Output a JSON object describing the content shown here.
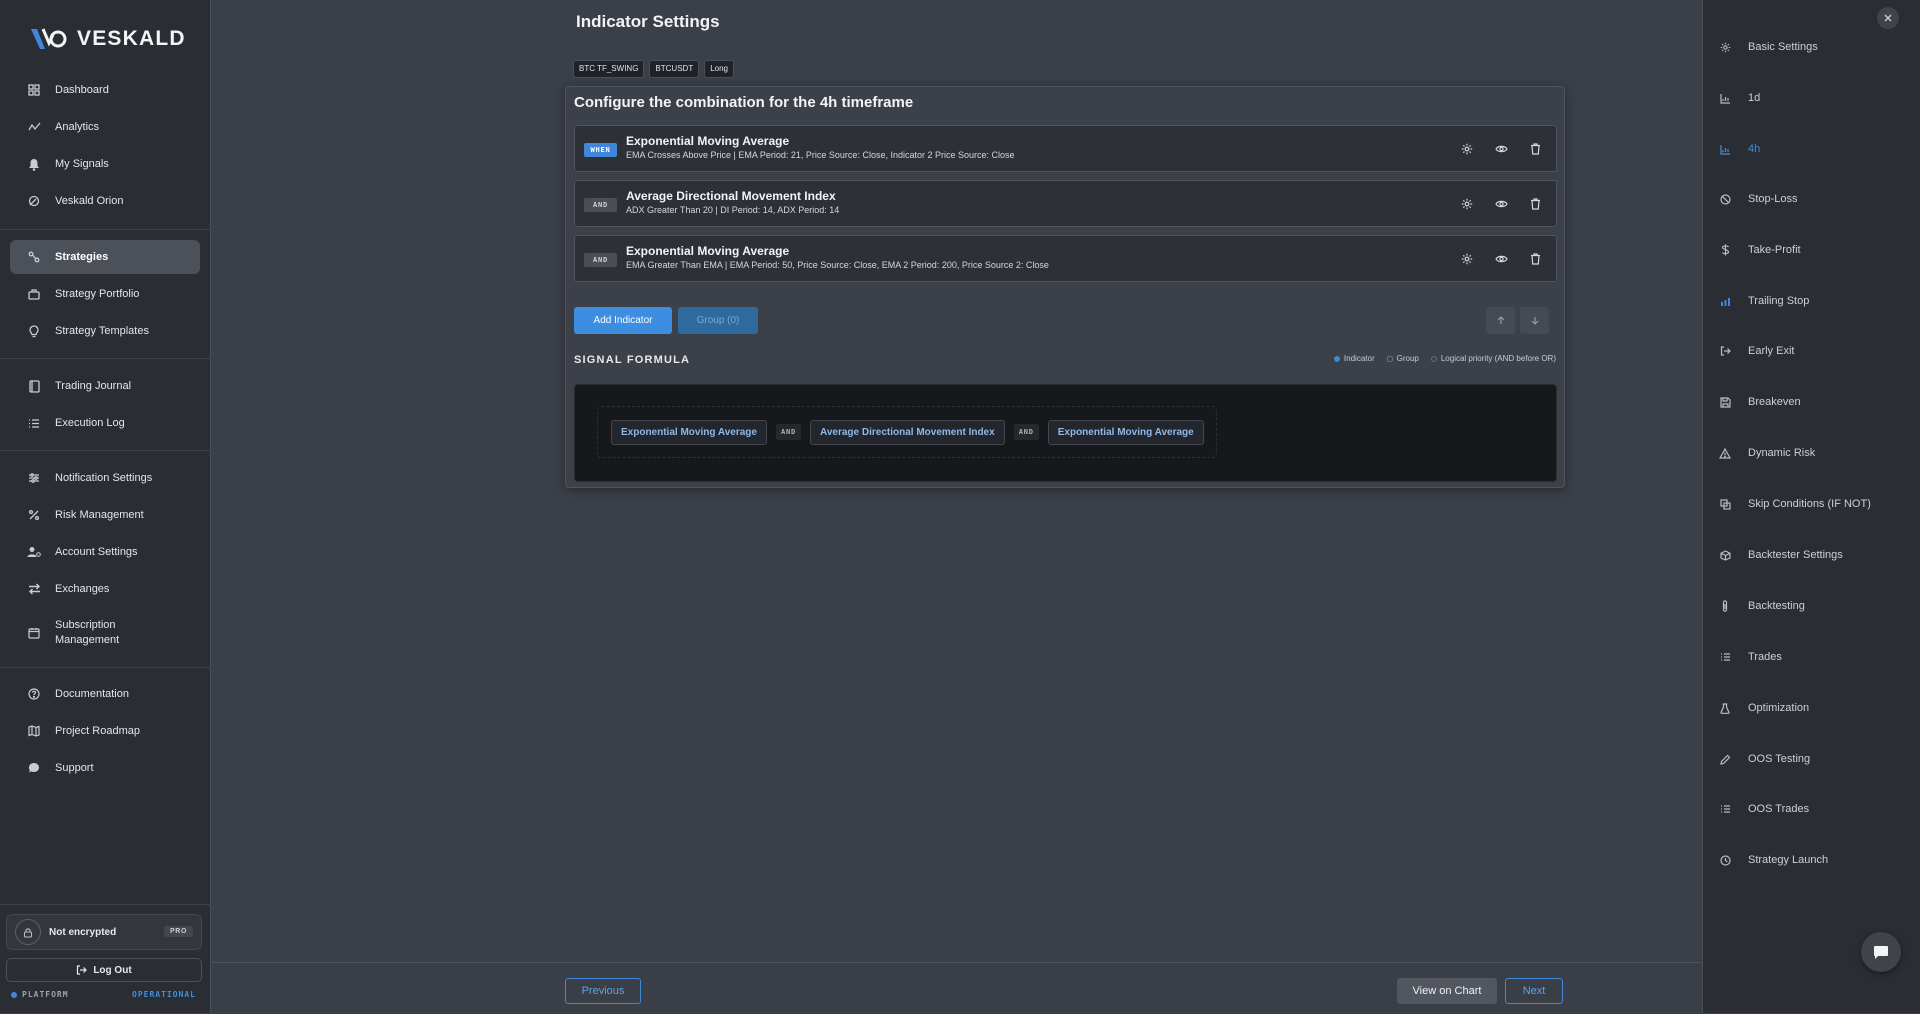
{
  "brand": {
    "name": "VESKALD"
  },
  "sidebar": {
    "items": [
      {
        "label": "Dashboard",
        "icon": "grid-icon"
      },
      {
        "label": "Analytics",
        "icon": "activity-icon"
      },
      {
        "label": "My Signals",
        "icon": "bell-icon"
      },
      {
        "label": "Veskald Orion",
        "icon": "orion-icon"
      },
      {
        "label": "Strategies",
        "icon": "route-icon",
        "active": true
      },
      {
        "label": "Strategy Portfolio",
        "icon": "briefcase-icon"
      },
      {
        "label": "Strategy Templates",
        "icon": "lightbulb-icon"
      },
      {
        "label": "Trading Journal",
        "icon": "book-icon"
      },
      {
        "label": "Execution Log",
        "icon": "list-icon"
      },
      {
        "label": "Notification Settings",
        "icon": "sliders-icon"
      },
      {
        "label": "Risk Management",
        "icon": "percent-icon"
      },
      {
        "label": "Account Settings",
        "icon": "user-gear-icon"
      },
      {
        "label": "Exchanges",
        "icon": "arrows-icon"
      },
      {
        "label": "Subscription Management",
        "icon": "calendar-gear-icon"
      },
      {
        "label": "Documentation",
        "icon": "help-circle-icon"
      },
      {
        "label": "Project Roadmap",
        "icon": "map-icon"
      },
      {
        "label": "Support",
        "icon": "chat-bubble-icon"
      }
    ],
    "encryption_text": "Not encrypted",
    "plan_badge": "PRO",
    "logout_label": "Log Out",
    "platform_label": "PLATFORM",
    "platform_status": "OPERATIONAL"
  },
  "main": {
    "title": "Indicator Settings",
    "tags": [
      "BTC TF_SWING",
      "BTCUSDT",
      "Long"
    ],
    "panel_title": "Configure the combination for the 4h timeframe",
    "indicators": [
      {
        "op": "WHEN",
        "name": "Exponential Moving Average",
        "desc": "EMA Crosses Above Price | EMA Period: 21, Price Source: Close, Indicator 2 Price Source: Close"
      },
      {
        "op": "AND",
        "name": "Average Directional Movement Index",
        "desc": "ADX Greater Than 20 | DI Period: 14, ADX Period: 14"
      },
      {
        "op": "AND",
        "name": "Exponential Moving Average",
        "desc": "EMA Greater Than EMA | EMA Period: 50, Price Source: Close, EMA 2 Period: 200, Price Source 2: Close"
      }
    ],
    "add_indicator_label": "Add Indicator",
    "group_label": "Group (0)",
    "signal_formula_label": "SIGNAL FORMULA",
    "legend": [
      "Indicator",
      "Group",
      "Logical priority (AND before OR)"
    ],
    "formula": {
      "chips": [
        "Exponential Moving Average",
        "Average Directional Movement Index",
        "Exponential Moving Average"
      ],
      "operators": [
        "AND",
        "AND"
      ]
    },
    "previous_label": "Previous",
    "view_chart_label": "View on Chart",
    "next_label": "Next"
  },
  "steps": {
    "active_index": 2,
    "items": [
      {
        "label": "Basic Settings",
        "icon": "gear-icon"
      },
      {
        "label": "1d",
        "icon": "chart-icon"
      },
      {
        "label": "4h",
        "icon": "chart-icon"
      },
      {
        "label": "Stop-Loss",
        "icon": "ban-icon"
      },
      {
        "label": "Take-Profit",
        "icon": "dollar-icon"
      },
      {
        "label": "Trailing Stop",
        "icon": "bar-chart-icon"
      },
      {
        "label": "Early Exit",
        "icon": "exit-icon"
      },
      {
        "label": "Breakeven",
        "icon": "save-icon"
      },
      {
        "label": "Dynamic Risk",
        "icon": "warning-icon"
      },
      {
        "label": "Skip Conditions (IF NOT)",
        "icon": "copy-icon"
      },
      {
        "label": "Backtester Settings",
        "icon": "cube-icon"
      },
      {
        "label": "Backtesting",
        "icon": "thermometer-icon"
      },
      {
        "label": "Trades",
        "icon": "list-check-icon"
      },
      {
        "label": "Optimization",
        "icon": "flask-icon"
      },
      {
        "label": "OOS Testing",
        "icon": "pen-icon"
      },
      {
        "label": "OOS Trades",
        "icon": "list-check-icon"
      },
      {
        "label": "Strategy Launch",
        "icon": "clock-icon"
      }
    ]
  }
}
